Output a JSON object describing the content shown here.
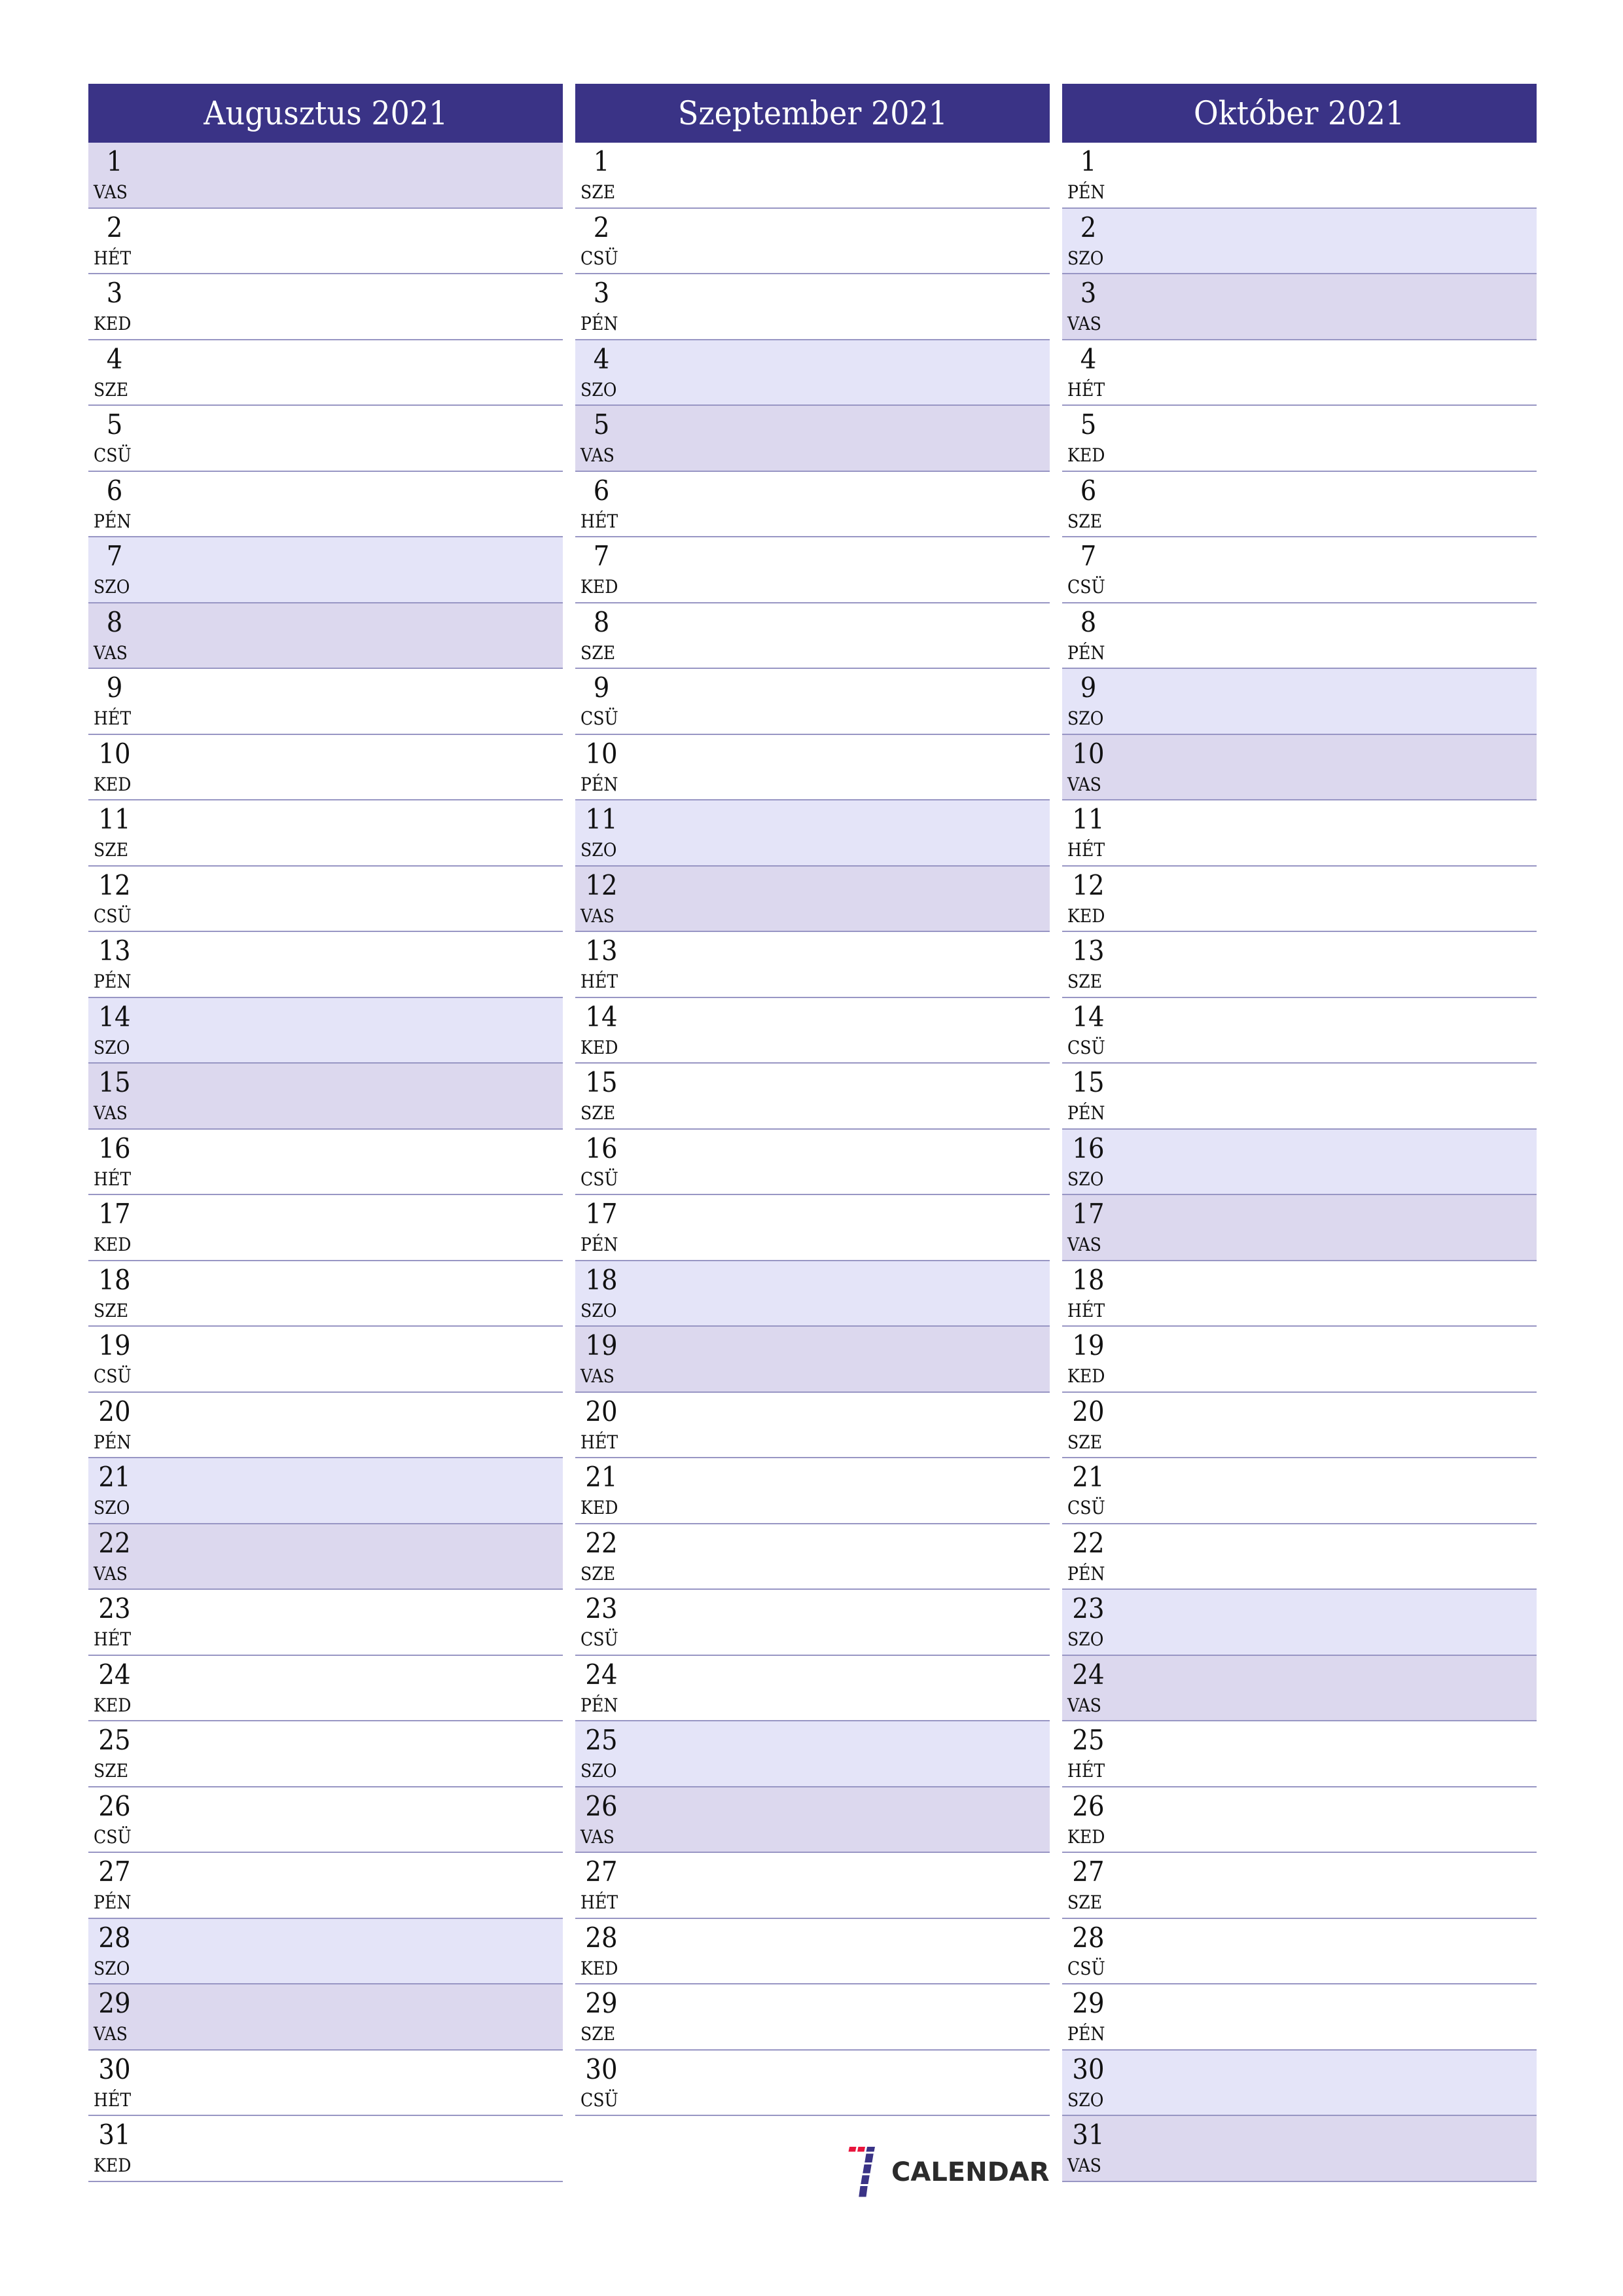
{
  "colors": {
    "header": "#3a3386",
    "saturday": "#e4e4f8",
    "sunday": "#dcd8ee",
    "divider": "#9896c4"
  },
  "months": [
    {
      "title": "Augusztus 2021",
      "days": [
        {
          "d": "1",
          "w": "VAS"
        },
        {
          "d": "2",
          "w": "HÉT"
        },
        {
          "d": "3",
          "w": "KED"
        },
        {
          "d": "4",
          "w": "SZE"
        },
        {
          "d": "5",
          "w": "CSÜ"
        },
        {
          "d": "6",
          "w": "PÉN"
        },
        {
          "d": "7",
          "w": "SZO"
        },
        {
          "d": "8",
          "w": "VAS"
        },
        {
          "d": "9",
          "w": "HÉT"
        },
        {
          "d": "10",
          "w": "KED"
        },
        {
          "d": "11",
          "w": "SZE"
        },
        {
          "d": "12",
          "w": "CSÜ"
        },
        {
          "d": "13",
          "w": "PÉN"
        },
        {
          "d": "14",
          "w": "SZO"
        },
        {
          "d": "15",
          "w": "VAS"
        },
        {
          "d": "16",
          "w": "HÉT"
        },
        {
          "d": "17",
          "w": "KED"
        },
        {
          "d": "18",
          "w": "SZE"
        },
        {
          "d": "19",
          "w": "CSÜ"
        },
        {
          "d": "20",
          "w": "PÉN"
        },
        {
          "d": "21",
          "w": "SZO"
        },
        {
          "d": "22",
          "w": "VAS"
        },
        {
          "d": "23",
          "w": "HÉT"
        },
        {
          "d": "24",
          "w": "KED"
        },
        {
          "d": "25",
          "w": "SZE"
        },
        {
          "d": "26",
          "w": "CSÜ"
        },
        {
          "d": "27",
          "w": "PÉN"
        },
        {
          "d": "28",
          "w": "SZO"
        },
        {
          "d": "29",
          "w": "VAS"
        },
        {
          "d": "30",
          "w": "HÉT"
        },
        {
          "d": "31",
          "w": "KED"
        }
      ]
    },
    {
      "title": "Szeptember 2021",
      "days": [
        {
          "d": "1",
          "w": "SZE"
        },
        {
          "d": "2",
          "w": "CSÜ"
        },
        {
          "d": "3",
          "w": "PÉN"
        },
        {
          "d": "4",
          "w": "SZO"
        },
        {
          "d": "5",
          "w": "VAS"
        },
        {
          "d": "6",
          "w": "HÉT"
        },
        {
          "d": "7",
          "w": "KED"
        },
        {
          "d": "8",
          "w": "SZE"
        },
        {
          "d": "9",
          "w": "CSÜ"
        },
        {
          "d": "10",
          "w": "PÉN"
        },
        {
          "d": "11",
          "w": "SZO"
        },
        {
          "d": "12",
          "w": "VAS"
        },
        {
          "d": "13",
          "w": "HÉT"
        },
        {
          "d": "14",
          "w": "KED"
        },
        {
          "d": "15",
          "w": "SZE"
        },
        {
          "d": "16",
          "w": "CSÜ"
        },
        {
          "d": "17",
          "w": "PÉN"
        },
        {
          "d": "18",
          "w": "SZO"
        },
        {
          "d": "19",
          "w": "VAS"
        },
        {
          "d": "20",
          "w": "HÉT"
        },
        {
          "d": "21",
          "w": "KED"
        },
        {
          "d": "22",
          "w": "SZE"
        },
        {
          "d": "23",
          "w": "CSÜ"
        },
        {
          "d": "24",
          "w": "PÉN"
        },
        {
          "d": "25",
          "w": "SZO"
        },
        {
          "d": "26",
          "w": "VAS"
        },
        {
          "d": "27",
          "w": "HÉT"
        },
        {
          "d": "28",
          "w": "KED"
        },
        {
          "d": "29",
          "w": "SZE"
        },
        {
          "d": "30",
          "w": "CSÜ"
        }
      ]
    },
    {
      "title": "Október 2021",
      "days": [
        {
          "d": "1",
          "w": "PÉN"
        },
        {
          "d": "2",
          "w": "SZO"
        },
        {
          "d": "3",
          "w": "VAS"
        },
        {
          "d": "4",
          "w": "HÉT"
        },
        {
          "d": "5",
          "w": "KED"
        },
        {
          "d": "6",
          "w": "SZE"
        },
        {
          "d": "7",
          "w": "CSÜ"
        },
        {
          "d": "8",
          "w": "PÉN"
        },
        {
          "d": "9",
          "w": "SZO"
        },
        {
          "d": "10",
          "w": "VAS"
        },
        {
          "d": "11",
          "w": "HÉT"
        },
        {
          "d": "12",
          "w": "KED"
        },
        {
          "d": "13",
          "w": "SZE"
        },
        {
          "d": "14",
          "w": "CSÜ"
        },
        {
          "d": "15",
          "w": "PÉN"
        },
        {
          "d": "16",
          "w": "SZO"
        },
        {
          "d": "17",
          "w": "VAS"
        },
        {
          "d": "18",
          "w": "HÉT"
        },
        {
          "d": "19",
          "w": "KED"
        },
        {
          "d": "20",
          "w": "SZE"
        },
        {
          "d": "21",
          "w": "CSÜ"
        },
        {
          "d": "22",
          "w": "PÉN"
        },
        {
          "d": "23",
          "w": "SZO"
        },
        {
          "d": "24",
          "w": "VAS"
        },
        {
          "d": "25",
          "w": "HÉT"
        },
        {
          "d": "26",
          "w": "KED"
        },
        {
          "d": "27",
          "w": "SZE"
        },
        {
          "d": "28",
          "w": "CSÜ"
        },
        {
          "d": "29",
          "w": "PÉN"
        },
        {
          "d": "30",
          "w": "SZO"
        },
        {
          "d": "31",
          "w": "VAS"
        }
      ]
    }
  ],
  "weekend": {
    "saturday": "SZO",
    "sunday": "VAS"
  },
  "logo": {
    "icon": "seven-calendar-logo-icon",
    "text": "CALENDAR"
  }
}
